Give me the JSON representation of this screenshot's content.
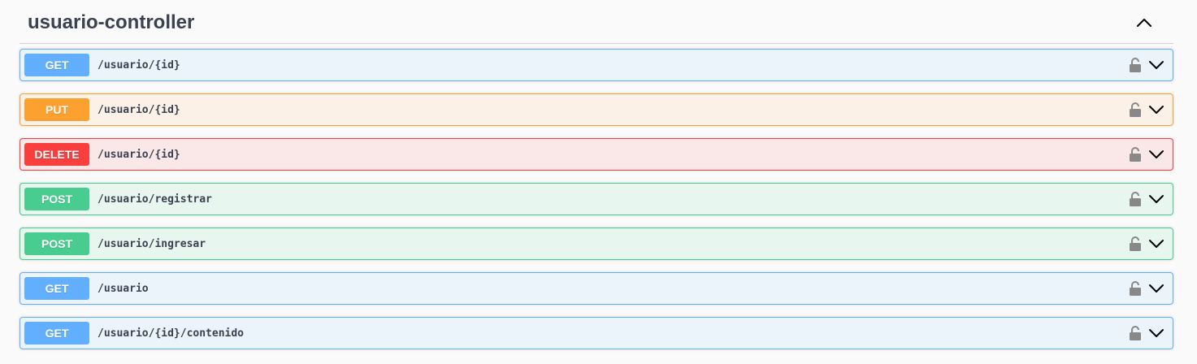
{
  "section": {
    "title": "usuario-controller",
    "collapse_icon": "chevron-up-icon"
  },
  "operations": [
    {
      "method": "GET",
      "path": "/usuario/{id}",
      "color": "#61affe"
    },
    {
      "method": "PUT",
      "path": "/usuario/{id}",
      "color": "#fca130"
    },
    {
      "method": "DELETE",
      "path": "/usuario/{id}",
      "color": "#f93e3e"
    },
    {
      "method": "POST",
      "path": "/usuario/registrar",
      "color": "#49cc90"
    },
    {
      "method": "POST",
      "path": "/usuario/ingresar",
      "color": "#49cc90"
    },
    {
      "method": "GET",
      "path": "/usuario",
      "color": "#61affe"
    },
    {
      "method": "GET",
      "path": "/usuario/{id}/contenido",
      "color": "#61affe"
    }
  ],
  "icons": {
    "lock": "lock-icon",
    "expand": "chevron-down-icon"
  }
}
